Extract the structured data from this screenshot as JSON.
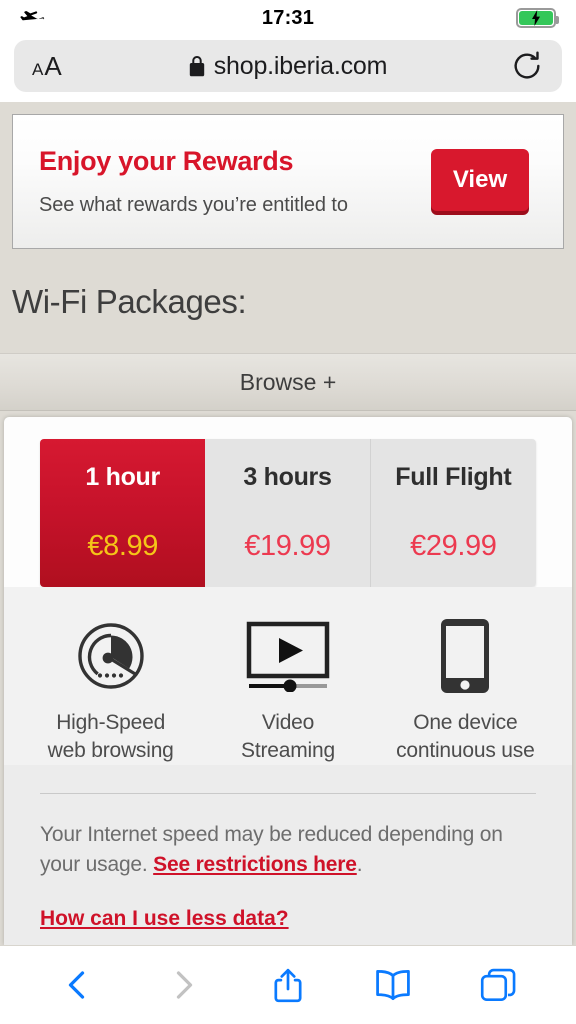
{
  "status_bar": {
    "airplane_icon": "airplane-mode-icon",
    "time": "17:31",
    "battery_icon": "battery-charging-icon"
  },
  "browser": {
    "text_size_small": "A",
    "text_size_large": "A",
    "lock_icon": "lock-icon",
    "url": "shop.iberia.com",
    "reload_icon": "reload-icon"
  },
  "rewards_banner": {
    "title": "Enjoy your Rewards",
    "subtitle": "See what rewards you’re entitled to",
    "button_label": "View"
  },
  "page": {
    "heading": "Wi-Fi Packages:",
    "browse_tab_label": "Browse +"
  },
  "packages": {
    "selected_index": 0,
    "items": [
      {
        "name": "1 hour",
        "price": "€8.99"
      },
      {
        "name": "3 hours",
        "price": "€19.99"
      },
      {
        "name": "Full Flight",
        "price": "€29.99"
      }
    ]
  },
  "features": [
    {
      "icon": "speedometer-icon",
      "line1": "High-Speed",
      "line2": "web browsing"
    },
    {
      "icon": "video-player-icon",
      "line1": "Video",
      "line2": "Streaming"
    },
    {
      "icon": "smartphone-icon",
      "line1": "One device",
      "line2": "continuous use"
    }
  ],
  "disclaimer": {
    "text_before": "Your Internet speed may be reduced depending on your usage. ",
    "link_restrictions": "See restrictions here",
    "text_after": ".",
    "link_less_data": "How can I use less data?"
  },
  "toolbar": {
    "back": "back-icon",
    "forward": "forward-icon",
    "share": "share-icon",
    "bookmarks": "bookmarks-icon",
    "tabs": "tabs-icon"
  },
  "colors": {
    "brand_red": "#d8152a",
    "selected_tab_red": "#c5122a",
    "price_red": "#ec3a50",
    "gold": "#f5c518",
    "safari_blue": "#0a7aff",
    "page_bg": "#dedbd4"
  }
}
